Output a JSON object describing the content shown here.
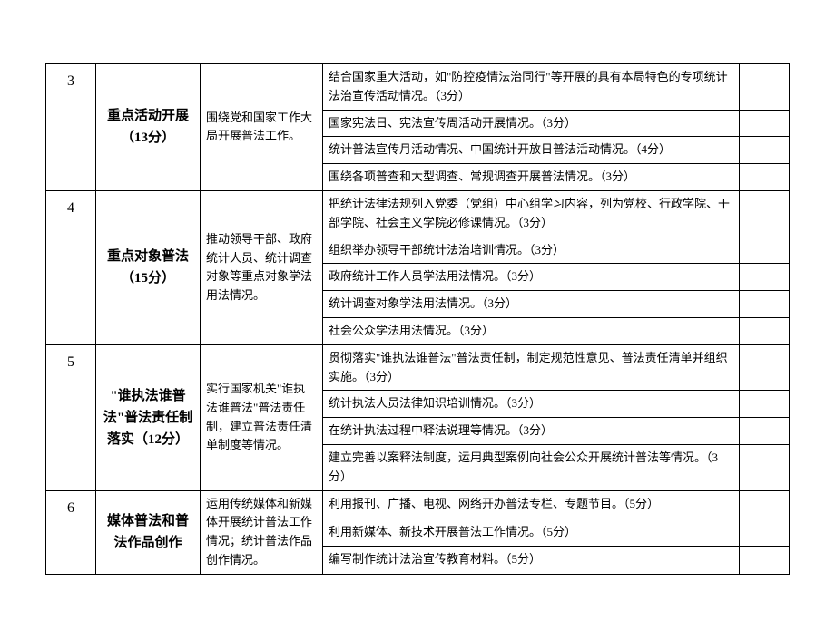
{
  "rows": [
    {
      "num": "3",
      "title": "重点活动开展（13分）",
      "desc": "围绕党和国家工作大局开展普法工作。",
      "details": [
        "结合国家重大活动，如\"防控疫情法治同行\"等开展的具有本局特色的专项统计法治宣传活动情况。（3分）",
        "国家宪法日、宪法宣传周活动开展情况。（3分）",
        "统计普法宣传月活动情况、中国统计开放日普法活动情况。（4分）",
        "围绕各项普查和大型调查、常规调查开展普法情况。（3分）"
      ]
    },
    {
      "num": "4",
      "title": "重点对象普法（15分）",
      "desc": "推动领导干部、政府统计人员、统计调查对象等重点对象学法用法情况。",
      "details": [
        "把统计法律法规列入党委（党组）中心组学习内容，列为党校、行政学院、干部学院、社会主义学院必修课情况。（3分）",
        "组织举办领导干部统计法治培训情况。（3分）",
        "政府统计工作人员学法用法情况。（3分）",
        "统计调查对象学法用法情况。（3分）",
        "社会公众学法用法情况。（3分）"
      ]
    },
    {
      "num": "5",
      "title": "\"谁执法谁普法\"普法责任制落实（12分）",
      "desc": "实行国家机关\"谁执法谁普法\"普法责任制，建立普法责任清单制度等情况。",
      "details": [
        "贯彻落实\"谁执法谁普法\"普法责任制，制定规范性意见、普法责任清单并组织实施。（3分）",
        "统计执法人员法律知识培训情况。（3分）",
        "在统计执法过程中释法说理等情况。（3分）",
        "建立完善以案释法制度，运用典型案例向社会公众开展统计普法等情况。（3分）"
      ]
    },
    {
      "num": "6",
      "title": "媒体普法和普法作品创作",
      "desc": "运用传统媒体和新媒体开展统计普法工作情况；统计普法作品创作情况。",
      "details": [
        "利用报刊、广播、电视、网络开办普法专栏、专题节目。（5分）",
        "利用新媒体、新技术开展普法工作情况。（5分）",
        "编写制作统计法治宣传教育材料。（5分）"
      ]
    }
  ]
}
